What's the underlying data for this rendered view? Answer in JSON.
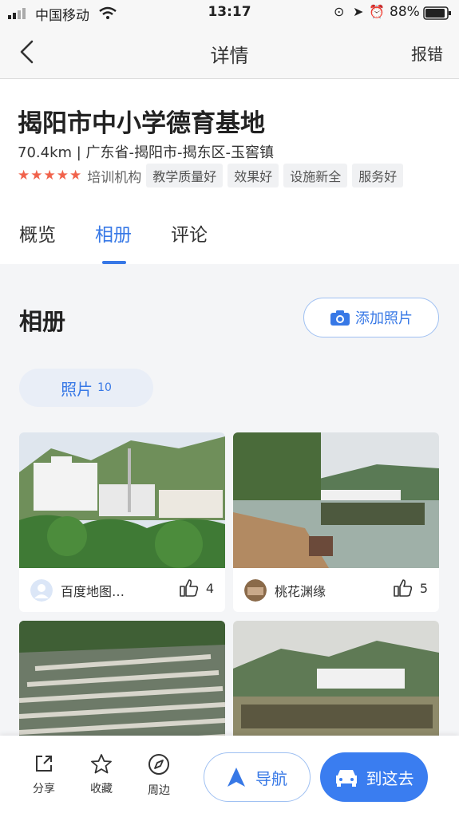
{
  "status_bar": {
    "carrier": "中国移动",
    "time": "13:17",
    "battery": "88%"
  },
  "nav": {
    "title": "详情",
    "report": "报错"
  },
  "poi": {
    "name": "揭阳市中小学德育基地",
    "address": "70.4km | 广东省-揭阳市-揭东区-玉窖镇",
    "rating_stars": 5,
    "category": "培训机构",
    "tags": [
      "教学质量好",
      "效果好",
      "设施新全",
      "服务好"
    ]
  },
  "tabs": [
    {
      "label": "概览"
    },
    {
      "label": "相册"
    },
    {
      "label": "评论"
    }
  ],
  "album": {
    "title": "相册",
    "add_photo": "添加照片",
    "chip_label": "照片",
    "chip_count": "10",
    "photos": [
      {
        "author": "百度地图…",
        "likes": "4"
      },
      {
        "author": "桃花渊缘",
        "likes": "5"
      }
    ]
  },
  "bottom_bar": {
    "share": "分享",
    "favorite": "收藏",
    "nearby": "周边",
    "navigate": "导航",
    "go_here": "到这去"
  },
  "colors": {
    "accent": "#3778e6",
    "star": "#f1624b",
    "primary_button": "#3a7df0"
  }
}
